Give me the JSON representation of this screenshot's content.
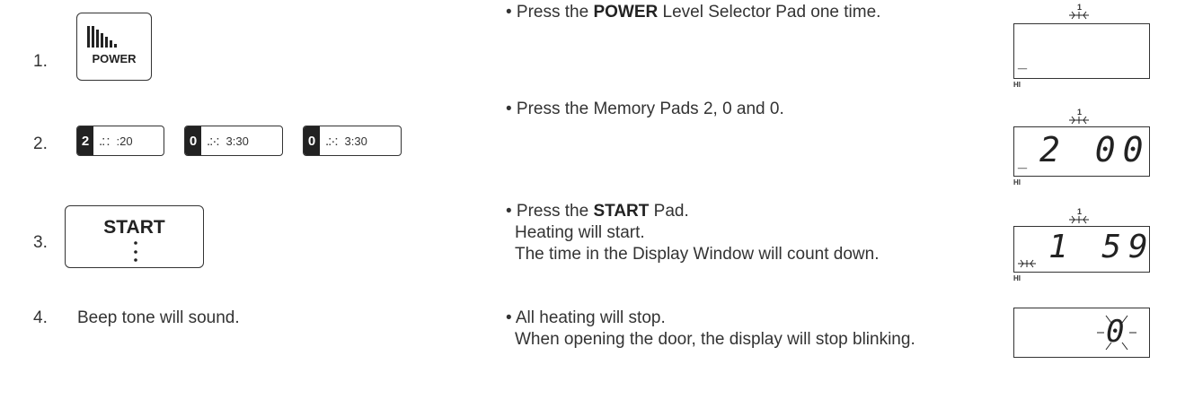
{
  "steps": [
    {
      "number": "1.",
      "text_pre": "• Press the ",
      "bold": "POWER",
      "text_post": " Level Selector Pad one time."
    },
    {
      "number": "2.",
      "text": "• Press the Memory Pads 2, 0 and 0."
    },
    {
      "number": "3.",
      "text_pre": "• Press the ",
      "bold": "START",
      "text_post": " Pad.",
      "line2": "Heating will start.",
      "line3": "The time in the Display Window will count down."
    },
    {
      "number": "4.",
      "left_text": "Beep tone will sound.",
      "text": "• All heating will stop.",
      "line2": "When opening the door, the display will stop blinking."
    }
  ],
  "power_pad": {
    "label": "POWER",
    "icon": "power-bars-icon"
  },
  "memory_pads": [
    {
      "digit": "2",
      "dots": ".: :",
      "time": ":20"
    },
    {
      "digit": "0",
      "dots": ".:·:",
      "time": "3:30"
    },
    {
      "digit": "0",
      "dots": ".:·:",
      "time": "3:30"
    }
  ],
  "start_pad": {
    "label": "START",
    "icon": "tactile-dots-icon"
  },
  "displays": [
    {
      "top": "1",
      "main": "",
      "corner": "_",
      "level": "HI"
    },
    {
      "top": "1",
      "main": "2 00",
      "corner": "_",
      "level": "HI"
    },
    {
      "top": "1",
      "main": "1 59",
      "corner": "",
      "level": "HI"
    },
    {
      "top": "",
      "main": "0",
      "corner": "",
      "level": ""
    }
  ]
}
